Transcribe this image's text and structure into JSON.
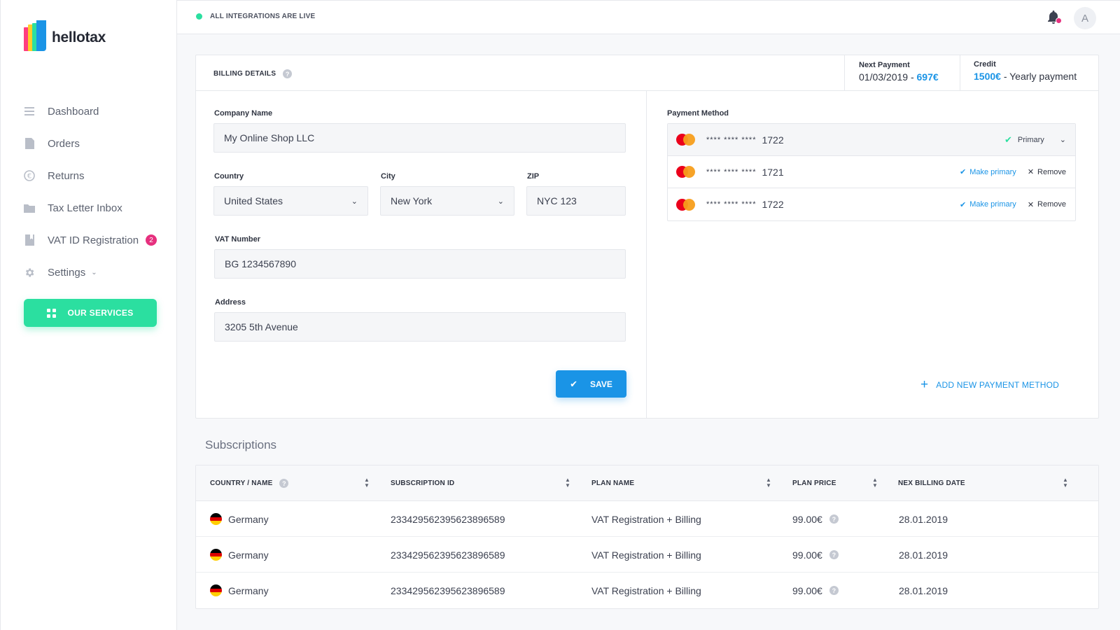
{
  "app": {
    "name": "hellotax"
  },
  "sidebar": {
    "items": [
      {
        "label": "Dashboard",
        "icon": "menu-lines-icon"
      },
      {
        "label": "Orders",
        "icon": "document-icon"
      },
      {
        "label": "Returns",
        "icon": "euro-icon"
      },
      {
        "label": "Tax Letter Inbox",
        "icon": "folder-icon"
      },
      {
        "label": "VAT ID Registration",
        "icon": "bookmark-doc-icon",
        "badge": "2"
      },
      {
        "label": "Settings",
        "icon": "gear-icon"
      }
    ],
    "services_button": "OUR SERVICES"
  },
  "topbar": {
    "status": "ALL INTEGRATIONS ARE LIVE",
    "avatar_initial": "A"
  },
  "billing": {
    "title": "BILLING DETAILS",
    "help": "?",
    "next_payment": {
      "label": "Next Payment",
      "date": "01/03/2019 - ",
      "amount": "697€"
    },
    "credit": {
      "label": "Credit",
      "amount": "1500€",
      "note": " - Yearly payment"
    },
    "form": {
      "company_label": "Company Name",
      "company_value": "My Online Shop LLC",
      "country_label": "Country",
      "country_value": "United States",
      "city_label": "City",
      "city_value": "New York",
      "zip_label": "ZIP",
      "zip_value": "NYC 123",
      "vat_label": "VAT Number",
      "vat_value": "BG 1234567890",
      "address_label": "Address",
      "address_value": "3205 5th Avenue",
      "save_label": "SAVE"
    },
    "payment": {
      "label": "Payment Method",
      "mask": "**** **** ****",
      "cards": [
        {
          "last4": "1722",
          "primary": true,
          "primary_label": "Primary"
        },
        {
          "last4": "1721",
          "primary": false
        },
        {
          "last4": "1722",
          "primary": false
        }
      ],
      "make_primary_label": "Make primary",
      "remove_label": "Remove",
      "add_label": "ADD NEW PAYMENT METHOD"
    }
  },
  "subscriptions": {
    "title": "Subscriptions",
    "columns": [
      "COUNTRY / NAME",
      "SUBSCRIPTION ID",
      "PLAN NAME",
      "PLAN PRICE",
      "NEX BILLING DATE"
    ],
    "rows": [
      {
        "country": "Germany",
        "id": "233429562395623896589",
        "plan": "VAT Registration + Billing",
        "price": "99.00€",
        "date": "28.01.2019"
      },
      {
        "country": "Germany",
        "id": "233429562395623896589",
        "plan": "VAT Registration + Billing",
        "price": "99.00€",
        "date": "28.01.2019"
      },
      {
        "country": "Germany",
        "id": "233429562395623896589",
        "plan": "VAT Registration + Billing",
        "price": "99.00€",
        "date": "28.01.2019"
      }
    ]
  },
  "colors": {
    "accent_green": "#2bdfa0",
    "accent_blue": "#1a94e6",
    "badge_pink": "#e6307e"
  }
}
